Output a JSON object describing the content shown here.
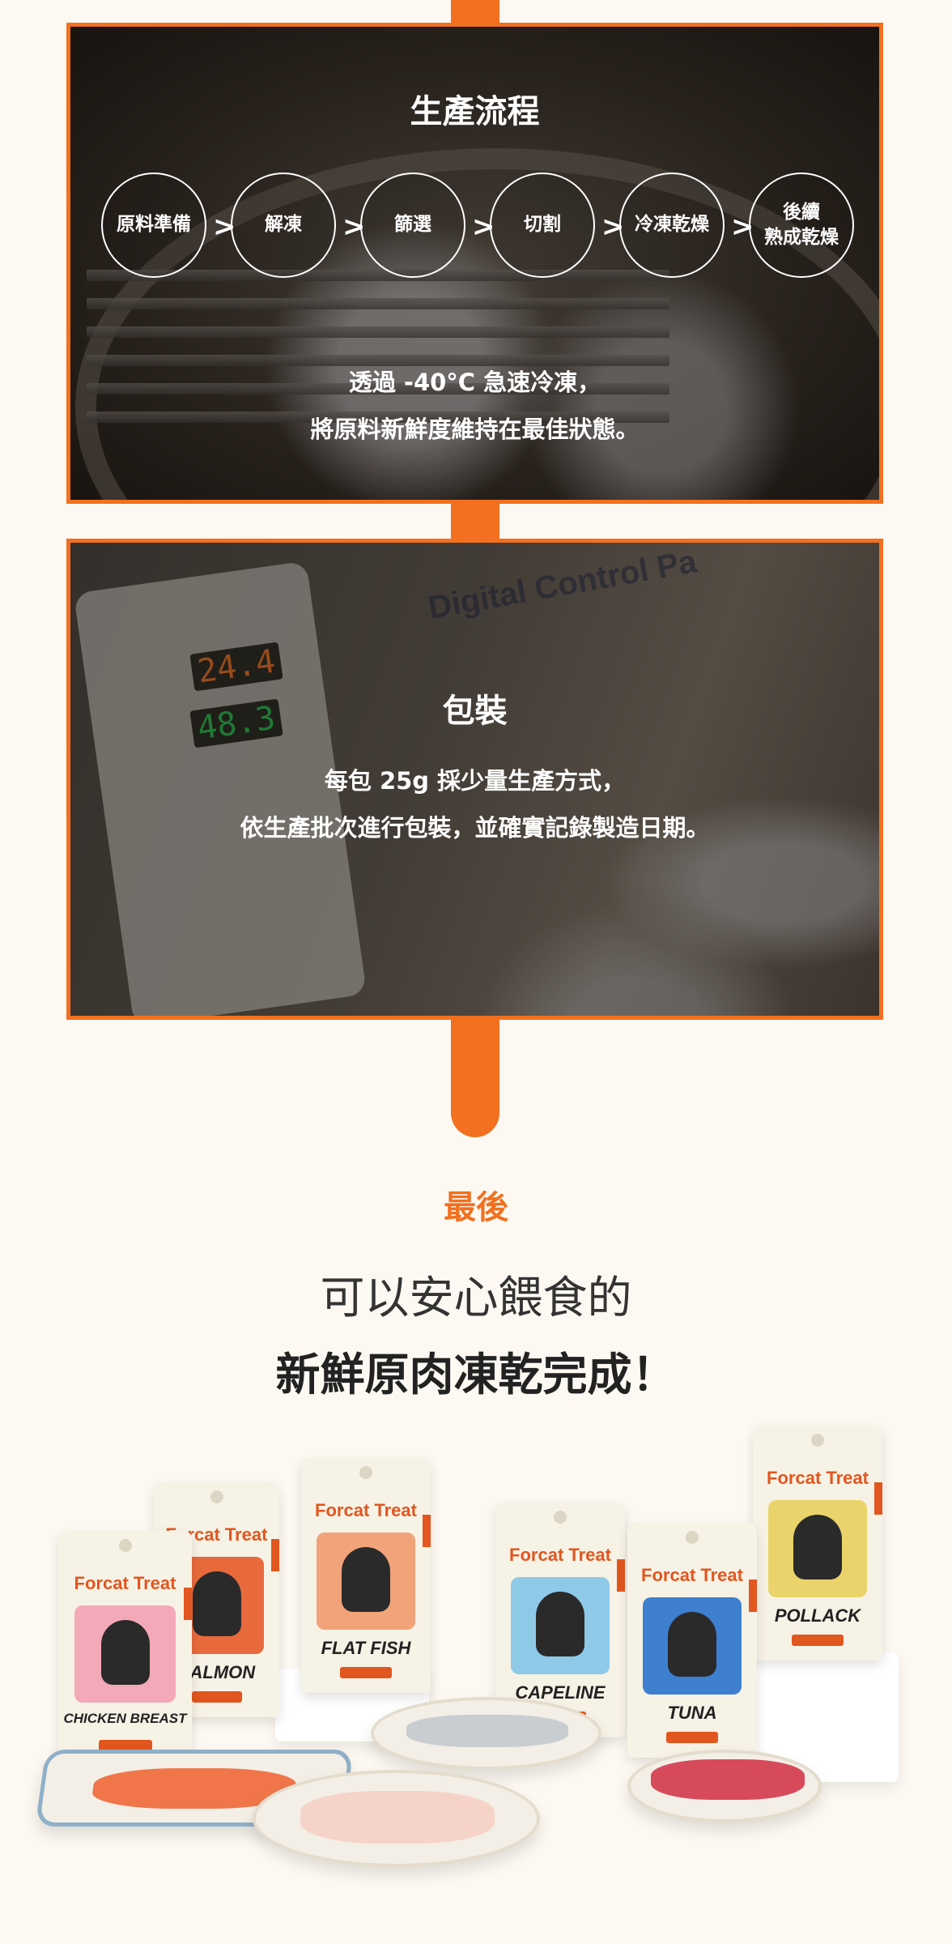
{
  "process": {
    "title": "生產流程",
    "steps": [
      "原料準備",
      "解凍",
      "篩選",
      "切割",
      "冷凍乾燥",
      "後續\n熟成乾燥"
    ],
    "text_line1": "透過 -40°C 急速冷凍，",
    "text_line2": "將原料新鮮度維持在最佳狀態。"
  },
  "packaging": {
    "panel_label": "Digital Control Pa",
    "led_top": "24.4",
    "led_bottom": "48.3",
    "title": "包裝",
    "text_line1": "每包 25g 採少量生產方式，",
    "text_line2": "依生產批次進行包裝，並確實記錄製造日期。"
  },
  "final": {
    "label": "最後",
    "line1": "可以安心餵食的",
    "line2": "新鮮原肉凍乾完成！"
  },
  "products": {
    "brand": "Forcat Treat",
    "names": [
      "CHICKEN BREAST",
      "SALMON",
      "FLAT FISH",
      "CAPELINE",
      "TUNA",
      "POLLACK"
    ]
  },
  "colors": {
    "accent": "#f2701f",
    "background": "#fdf9f2"
  }
}
